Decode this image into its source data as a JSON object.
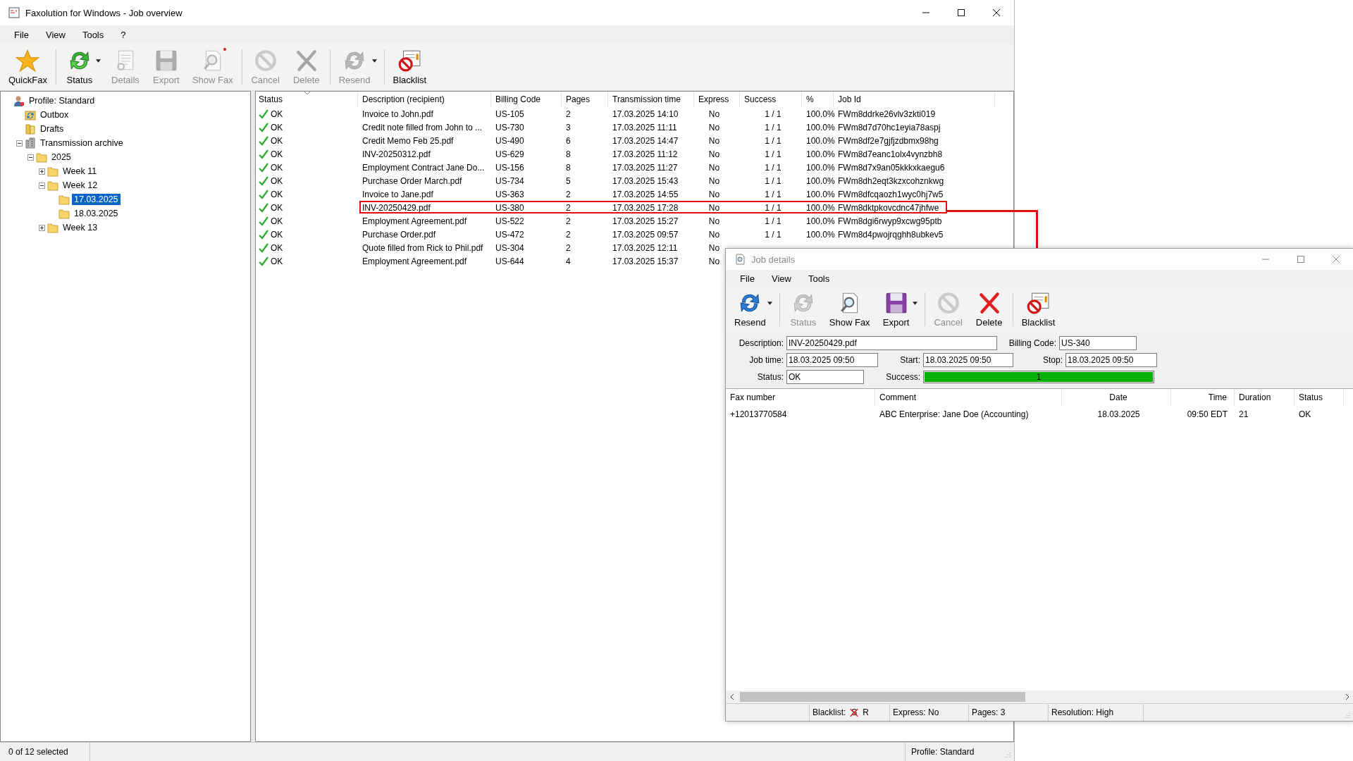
{
  "main_window": {
    "title": "Faxolution for Windows - Job overview",
    "menu": [
      "File",
      "View",
      "Tools",
      "?"
    ],
    "toolbar": [
      [
        {
          "kind": "quickfax",
          "label": "QuickFax",
          "disabled": false,
          "dropdown": false
        }
      ],
      [
        {
          "kind": "refresh",
          "label": "Status",
          "disabled": false,
          "dropdown": true
        },
        {
          "kind": "details",
          "label": "Details",
          "disabled": true,
          "dropdown": false
        },
        {
          "kind": "export",
          "label": "Export",
          "disabled": true,
          "dropdown": false
        },
        {
          "kind": "showfax",
          "label": "Show Fax",
          "disabled": true,
          "dropdown": false,
          "dot": true
        }
      ],
      [
        {
          "kind": "cancel",
          "label": "Cancel",
          "disabled": true,
          "dropdown": false
        },
        {
          "kind": "delete",
          "label": "Delete",
          "disabled": true,
          "dropdown": false
        }
      ],
      [
        {
          "kind": "resend",
          "label": "Resend",
          "disabled": true,
          "dropdown": true
        }
      ],
      [
        {
          "kind": "blacklist",
          "label": "Blacklist",
          "disabled": false,
          "dropdown": false
        }
      ]
    ],
    "tree": [
      {
        "kind": "profile",
        "label": "Profile: Standard",
        "selected": false,
        "children": [
          {
            "kind": "outbox",
            "label": "Outbox",
            "selected": false
          },
          {
            "kind": "drafts",
            "label": "Drafts",
            "selected": false
          },
          {
            "kind": "archive",
            "label": "Transmission archive",
            "selected": false,
            "expanded": true,
            "children": [
              {
                "kind": "folder",
                "label": "2025",
                "selected": false,
                "expanded": true,
                "children": [
                  {
                    "kind": "folder",
                    "label": "Week 11",
                    "selected": false,
                    "expanded": false
                  },
                  {
                    "kind": "folder",
                    "label": "Week 12",
                    "selected": false,
                    "expanded": true,
                    "children": [
                      {
                        "kind": "folder",
                        "label": "17.03.2025",
                        "selected": true
                      },
                      {
                        "kind": "folder",
                        "label": "18.03.2025",
                        "selected": false
                      }
                    ]
                  },
                  {
                    "kind": "folder",
                    "label": "Week 13",
                    "selected": false,
                    "expanded": false
                  }
                ]
              }
            ]
          }
        ]
      }
    ],
    "table": {
      "columns": [
        "Status",
        "Description (recipient)",
        "Billing Code",
        "Pages",
        "Transmission time",
        "Express",
        "Success",
        "%",
        "Job Id"
      ],
      "rows": [
        {
          "status": "OK",
          "description": "Invoice to John.pdf",
          "billing_code": "US-105",
          "pages": "2",
          "time": "17.03.2025 14:10",
          "express": "No",
          "success": "1 / 1",
          "percent": "100.0%",
          "job_id": "FWm8ddrke26vlv3zkti019",
          "annotated": false
        },
        {
          "status": "OK",
          "description": "Credit note filled from John to ...",
          "billing_code": "US-730",
          "pages": "3",
          "time": "17.03.2025 11:11",
          "express": "No",
          "success": "1 / 1",
          "percent": "100.0%",
          "job_id": "FWm8d7d70hc1eyia78aspj",
          "annotated": false
        },
        {
          "status": "OK",
          "description": "Credit Memo Feb 25.pdf",
          "billing_code": "US-490",
          "pages": "6",
          "time": "17.03.2025 14:47",
          "express": "No",
          "success": "1 / 1",
          "percent": "100.0%",
          "job_id": "FWm8df2e7gjfjzdbmx98hg",
          "annotated": false
        },
        {
          "status": "OK",
          "description": "INV-20250312.pdf",
          "billing_code": "US-629",
          "pages": "8",
          "time": "17.03.2025 11:12",
          "express": "No",
          "success": "1 / 1",
          "percent": "100.0%",
          "job_id": "FWm8d7eanc1olx4vynzbh8",
          "annotated": false
        },
        {
          "status": "OK",
          "description": "Employment Contract Jane Do...",
          "billing_code": "US-156",
          "pages": "8",
          "time": "17.03.2025 11:27",
          "express": "No",
          "success": "1 / 1",
          "percent": "100.0%",
          "job_id": "FWm8d7x9an05kkkxkaegu6",
          "annotated": false
        },
        {
          "status": "OK",
          "description": "Purchase Order March.pdf",
          "billing_code": "US-734",
          "pages": "5",
          "time": "17.03.2025 15:43",
          "express": "No",
          "success": "1 / 1",
          "percent": "100.0%",
          "job_id": "FWm8dh2eqt3kzxcohznkwg",
          "annotated": false
        },
        {
          "status": "OK",
          "description": "Invoice to Jane.pdf",
          "billing_code": "US-363",
          "pages": "2",
          "time": "17.03.2025 14:55",
          "express": "No",
          "success": "1 / 1",
          "percent": "100.0%",
          "job_id": "FWm8dfcqaozh1wyc0hj7w5",
          "annotated": false
        },
        {
          "status": "OK",
          "description": "INV-20250429.pdf",
          "billing_code": "US-380",
          "pages": "2",
          "time": "17.03.2025 17:28",
          "express": "No",
          "success": "1 / 1",
          "percent": "100.0%",
          "job_id": "FWm8dktpkovcdnc47jhfwe",
          "annotated": true
        },
        {
          "status": "OK",
          "description": "Employment Agreement.pdf",
          "billing_code": "US-522",
          "pages": "2",
          "time": "17.03.2025 15:27",
          "express": "No",
          "success": "1 / 1",
          "percent": "100.0%",
          "job_id": "FWm8dgi6rwyp9xcwg95ptb",
          "annotated": false
        },
        {
          "status": "OK",
          "description": "Purchase Order.pdf",
          "billing_code": "US-472",
          "pages": "2",
          "time": "17.03.2025 09:57",
          "express": "No",
          "success": "1 / 1",
          "percent": "100.0%",
          "job_id": "FWm8d4pwojrqghh8ubkev5",
          "annotated": false
        },
        {
          "status": "OK",
          "description": "Quote filled from Rick to Phil.pdf",
          "billing_code": "US-304",
          "pages": "2",
          "time": "17.03.2025 12:11",
          "express": "No",
          "annotated": false
        },
        {
          "status": "OK",
          "description": "Employment Agreement.pdf",
          "billing_code": "US-644",
          "pages": "4",
          "time": "17.03.2025 15:37",
          "express": "No",
          "annotated": false
        }
      ]
    },
    "status_bar": {
      "selection": "0 of 12 selected",
      "profile": "Profile: Standard"
    }
  },
  "job_details": {
    "title": "Job details",
    "menu": [
      "File",
      "View",
      "Tools"
    ],
    "toolbar": [
      [
        {
          "kind": "resend",
          "label": "Resend",
          "disabled": false,
          "dropdown": true
        }
      ],
      [
        {
          "kind": "refresh",
          "label": "Status",
          "disabled": true,
          "dropdown": false
        },
        {
          "kind": "showfax",
          "label": "Show Fax",
          "disabled": false,
          "dropdown": false
        },
        {
          "kind": "export",
          "label": "Export",
          "disabled": false,
          "dropdown": true
        }
      ],
      [
        {
          "kind": "cancel",
          "label": "Cancel",
          "disabled": true,
          "dropdown": false
        },
        {
          "kind": "delete",
          "label": "Delete",
          "disabled": false,
          "dropdown": false
        }
      ],
      [
        {
          "kind": "blacklist",
          "label": "Blacklist",
          "disabled": false,
          "dropdown": false
        }
      ]
    ],
    "form": [
      [
        {
          "kind": "text",
          "label": "Description:",
          "value": "INV-20250429.pdf"
        },
        {
          "kind": "text",
          "label": "Billing Code:",
          "value": "US-340"
        }
      ],
      [
        {
          "kind": "text",
          "label": "Job time:",
          "value": "18.03.2025 09:50"
        },
        {
          "kind": "text",
          "label": "Start:",
          "value": "18.03.2025 09:50"
        },
        {
          "kind": "text",
          "label": "Stop:",
          "value": "18.03.2025 09:50"
        }
      ],
      [
        {
          "kind": "text",
          "label": "Status:",
          "value": "OK"
        },
        {
          "kind": "bar",
          "label": "Success:",
          "value": "1",
          "level": 1
        }
      ]
    ],
    "table": {
      "columns": [
        "Fax number",
        "Comment",
        "Date",
        "Time",
        "Duration",
        "Status"
      ],
      "rows": [
        [
          "+12013770584",
          "ABC Enterprise: Jane Doe (Accounting)",
          "18.03.2025",
          "09:50 EDT",
          "21",
          "OK"
        ]
      ]
    },
    "status_bar": {
      "blacklist_label": "Blacklist:",
      "blacklist_flags": [
        {
          "text": "S",
          "crossed": true
        },
        {
          "text": "R",
          "crossed": false
        }
      ],
      "express": "Express: No",
      "pages": "Pages: 3",
      "resolution": "Resolution: High"
    }
  }
}
